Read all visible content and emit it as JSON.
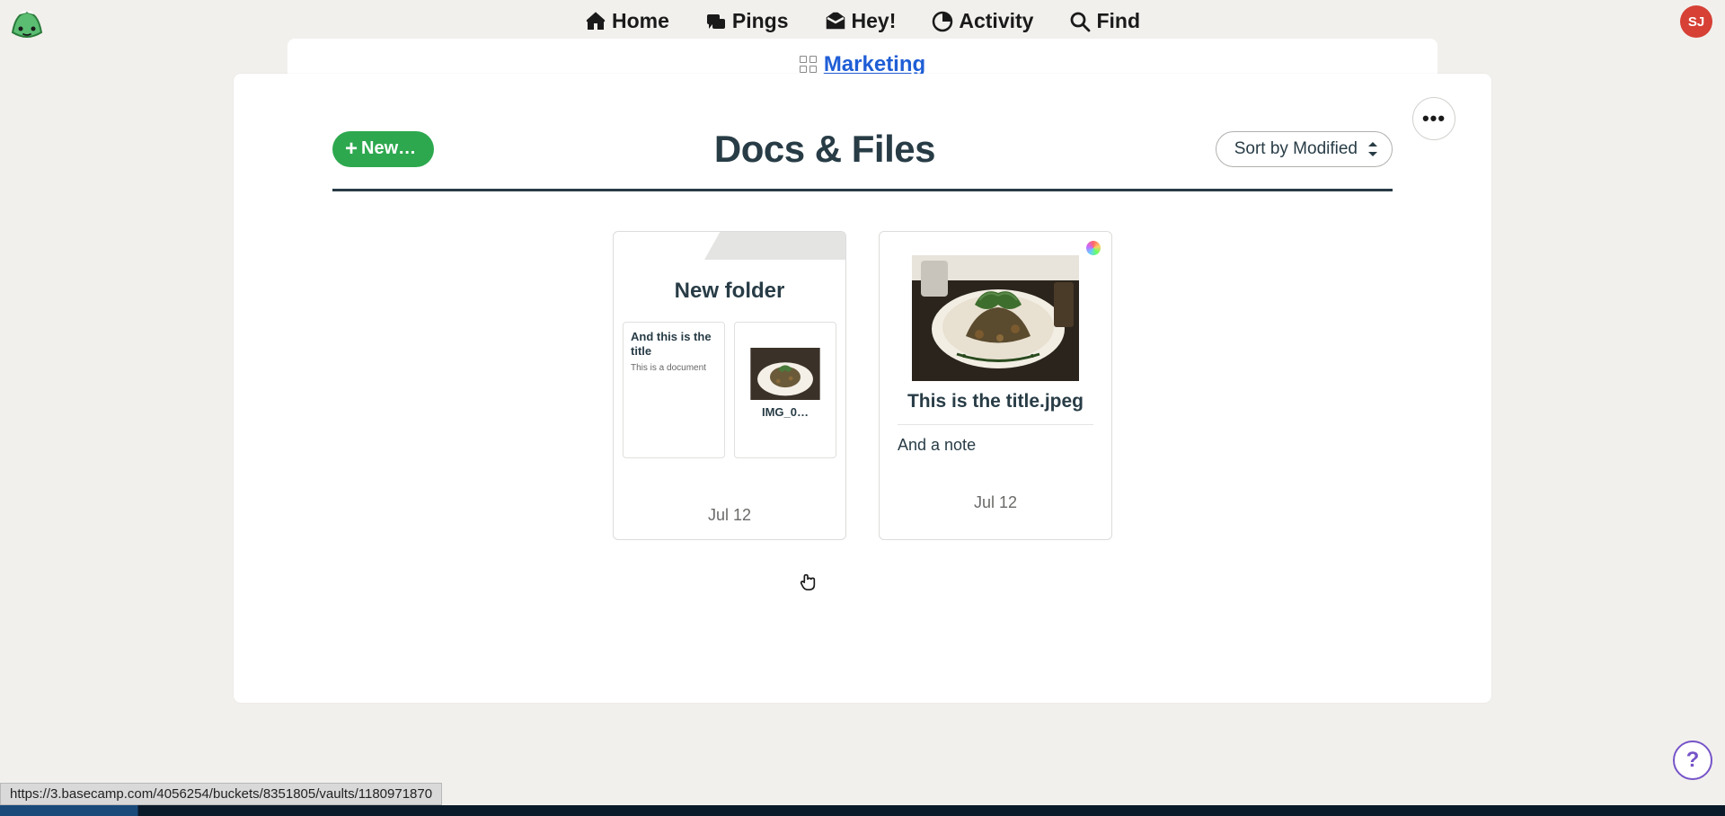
{
  "nav": {
    "home": "Home",
    "pings": "Pings",
    "hey": "Hey!",
    "activity": "Activity",
    "find": "Find"
  },
  "avatar": "SJ",
  "breadcrumb": "Marketing",
  "page_title": "Docs & Files",
  "new_button": "New…",
  "sort_label": "Sort by Modified",
  "more_dots": "•••",
  "folder": {
    "title": "New folder",
    "date": "Jul 12",
    "doc_title": "And this is the title",
    "doc_body": "This is a document",
    "img_label": "IMG_0…"
  },
  "file": {
    "title": "This is the title.jpeg",
    "note": "And a note",
    "date": "Jul 12"
  },
  "help": "?",
  "status_url": "https://3.basecamp.com/4056254/buckets/8351805/vaults/1180971870"
}
